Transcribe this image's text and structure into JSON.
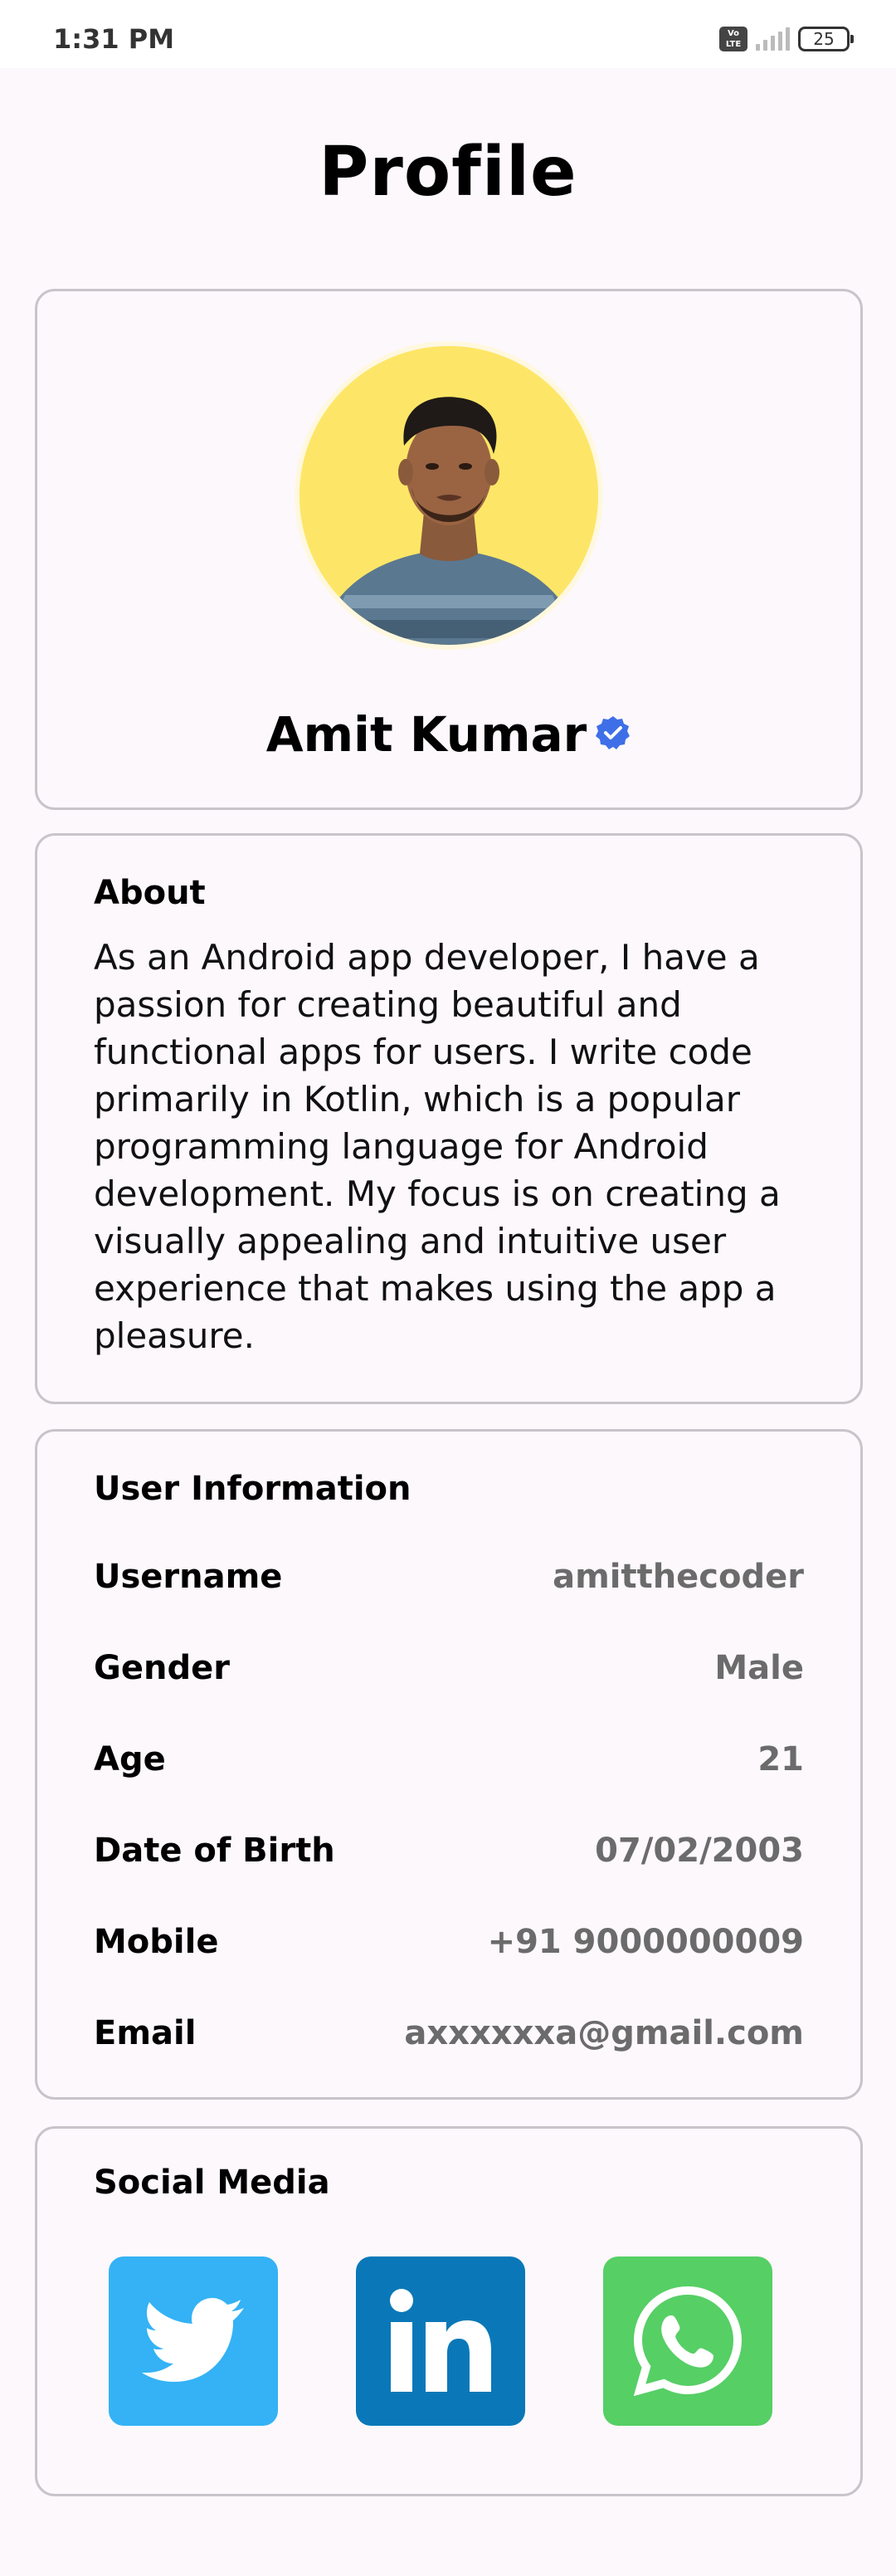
{
  "status_bar": {
    "time": "1:31 PM",
    "battery": "25",
    "volte": "Vo LTE"
  },
  "page": {
    "title": "Profile"
  },
  "profile": {
    "name": "Amit Kumar"
  },
  "about": {
    "header": "About",
    "text": "As an Android app developer, I have a passion for creating beautiful and functional apps for users. I write code primarily in Kotlin, which is a popular programming language for Android development. My focus is on creating a visually appealing and intuitive user experience that makes using the app a pleasure."
  },
  "user_info": {
    "header": "User Information",
    "rows": [
      {
        "label": "Username",
        "value": "amitthecoder"
      },
      {
        "label": "Gender",
        "value": "Male"
      },
      {
        "label": "Age",
        "value": "21"
      },
      {
        "label": "Date of Birth",
        "value": "07/02/2003"
      },
      {
        "label": "Mobile",
        "value": "+91 9000000009"
      },
      {
        "label": "Email",
        "value": "axxxxxxa@gmail.com"
      }
    ]
  },
  "social": {
    "header": "Social Media",
    "items": [
      {
        "name": "twitter-icon",
        "color": "#34b2f5"
      },
      {
        "name": "linkedin-icon",
        "color": "#0a78b8"
      },
      {
        "name": "whatsapp-icon",
        "color": "#56cf65"
      }
    ]
  },
  "colors": {
    "background": "#fcf8fc",
    "card_border": "#c9c4c9",
    "value_text": "#6b6b6b",
    "verified": "#3f6fe8"
  }
}
